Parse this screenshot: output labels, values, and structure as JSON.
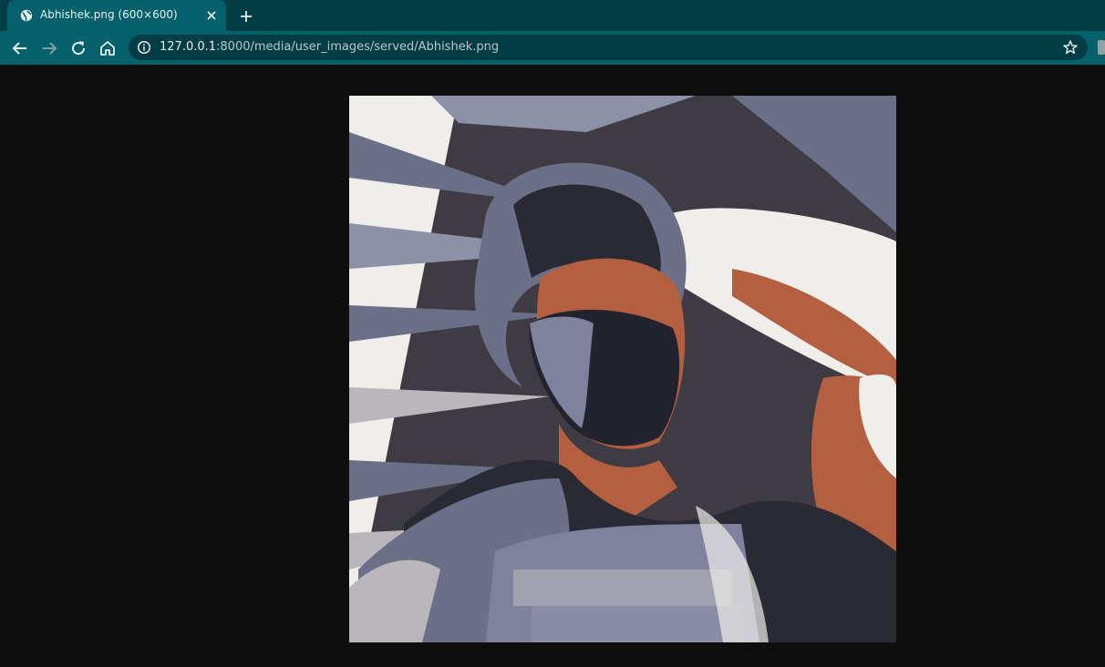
{
  "tab": {
    "title": "Abhishek.png (600×600)"
  },
  "address": {
    "host": "127.0.0.1",
    "rest": ":8000/media/user_images/served/Abhishek.png"
  },
  "image": {
    "alt": "Abhishek.png"
  },
  "colors": {
    "frame": "#023d45",
    "toolbar": "#04606a",
    "page_bg": "#0e0e0e"
  },
  "icons": [
    "globe-icon",
    "close-icon",
    "plus-icon",
    "back-arrow-icon",
    "forward-arrow-icon",
    "reload-icon",
    "home-icon",
    "info-icon",
    "star-icon",
    "extension-icon"
  ]
}
